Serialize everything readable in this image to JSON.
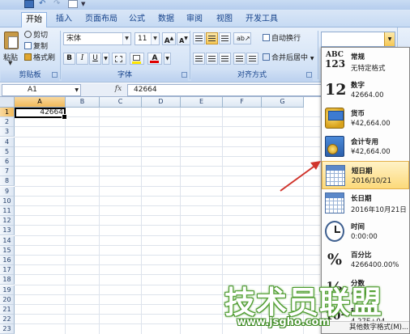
{
  "ribbon_tabs": [
    "开始",
    "插入",
    "页面布局",
    "公式",
    "数据",
    "审阅",
    "视图",
    "开发工具"
  ],
  "clipboard": {
    "paste": "粘贴",
    "cut": "剪切",
    "copy": "复制",
    "format_painter": "格式刷",
    "group": "剪贴板"
  },
  "font": {
    "name": "宋体",
    "size": "11",
    "grow": "A",
    "shrink": "A",
    "bold": "B",
    "italic": "I",
    "underline": "U",
    "font_color": "A",
    "group": "字体"
  },
  "alignment": {
    "wrap": "自动换行",
    "merge": "合并后居中",
    "group": "对齐方式"
  },
  "formula_bar": {
    "name_box": "A1",
    "fx": "fx",
    "value": "42664"
  },
  "grid": {
    "columns": [
      "A",
      "B",
      "C",
      "D",
      "E",
      "F",
      "G"
    ],
    "rows": [
      "1",
      "2",
      "3",
      "4",
      "5",
      "6",
      "7",
      "8",
      "9",
      "10",
      "11",
      "12",
      "13",
      "14",
      "15",
      "16",
      "17",
      "18",
      "19",
      "20",
      "21",
      "22",
      "23"
    ],
    "a1_value": "42664"
  },
  "number_format_menu": {
    "items": [
      {
        "name": "常规",
        "sample": "无特定格式",
        "icon": "abc-123-icon",
        "glyph_top": "ABC",
        "glyph_bottom": "123"
      },
      {
        "name": "数字",
        "sample": "42664.00",
        "icon": "number-12-icon",
        "glyph": "12"
      },
      {
        "name": "货币",
        "sample": "¥42,664.00",
        "icon": "currency-icon"
      },
      {
        "name": "会计专用",
        "sample": "¥42,664.00",
        "icon": "accounting-icon"
      },
      {
        "name": "短日期",
        "sample": "2016/10/21",
        "icon": "calendar-short-icon",
        "selected": true
      },
      {
        "name": "长日期",
        "sample": "2016年10月21日",
        "icon": "calendar-long-icon"
      },
      {
        "name": "时间",
        "sample": "0:00:00",
        "icon": "clock-icon"
      },
      {
        "name": "百分比",
        "sample": "4266400.00%",
        "icon": "percent-icon",
        "glyph": "%"
      },
      {
        "name": "分数",
        "sample": "42664",
        "icon": "fraction-icon",
        "glyph": "½"
      },
      {
        "name": "科学记数",
        "sample": "4.27E+04",
        "icon": "scientific-icon",
        "glyph": "10²"
      }
    ],
    "more": "其他数字格式(M)..."
  },
  "watermark": {
    "text": "技术员联盟",
    "url": "www.jsgho.com"
  },
  "colors": {
    "ribbon": "#d4e3f6",
    "selection_highlight": "#fcd97a",
    "annotation_arrow": "#d0342c",
    "watermark_green": "#3d8a22"
  }
}
